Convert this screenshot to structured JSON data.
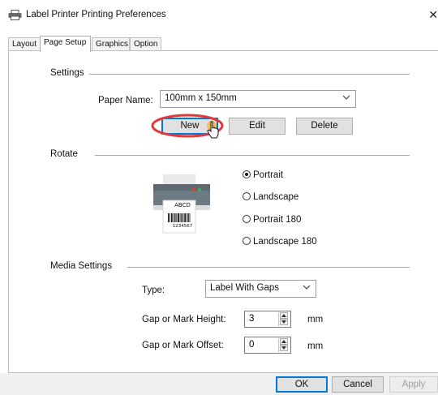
{
  "window": {
    "title": "Label Printer Printing Preferences",
    "close_glyph": "✕"
  },
  "tabs": [
    {
      "label": "Layout",
      "active": false
    },
    {
      "label": "Page Setup",
      "active": true
    },
    {
      "label": "Graphics",
      "active": false
    },
    {
      "label": "Option",
      "active": false
    }
  ],
  "settings": {
    "section_title": "Settings",
    "paper_name_label": "Paper Name:",
    "paper_name_value": "100mm x 150mm",
    "new_label": "New",
    "edit_label": "Edit",
    "delete_label": "Delete"
  },
  "rotate": {
    "section_title": "Rotate",
    "label_text": "ABCD",
    "barcode_number": "1234567",
    "options": [
      {
        "label": "Portrait",
        "selected": true
      },
      {
        "label": "Landscape",
        "selected": false
      },
      {
        "label": "Portrait 180",
        "selected": false
      },
      {
        "label": "Landscape 180",
        "selected": false
      }
    ]
  },
  "media": {
    "section_title": "Media Settings",
    "type_label": "Type:",
    "type_value": "Label With Gaps",
    "gap_height_label": "Gap or Mark Height:",
    "gap_height_value": "3",
    "gap_offset_label": "Gap or Mark Offset:",
    "gap_offset_value": "0",
    "unit": "mm"
  },
  "footer": {
    "ok_label": "OK",
    "cancel_label": "Cancel",
    "apply_label": "Apply"
  },
  "colors": {
    "highlight_ring": "#e03a3a",
    "focus_border": "#0078d7",
    "led_red": "#e23b2e",
    "led_green": "#3cb44b"
  },
  "icons": {
    "title_icon": "printer-icon",
    "cursor": "hand-cursor-icon"
  }
}
